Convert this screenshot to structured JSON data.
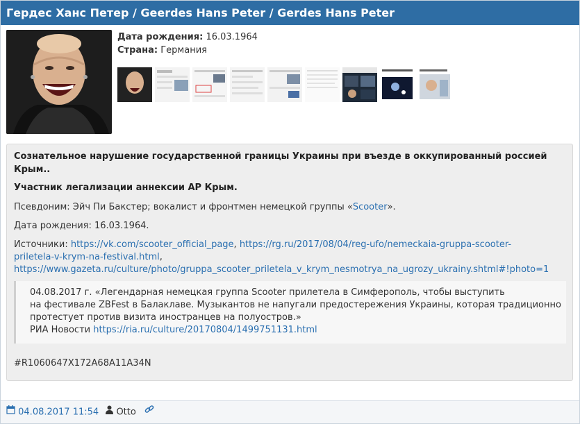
{
  "title": "Гердес Ханс Петер / Geerdes Hans Peter / Gerdes Hans Peter",
  "info": {
    "birth_label": "Дата рождения:",
    "birth_value": "16.03.1964",
    "country_label": "Страна:",
    "country_value": "Германия"
  },
  "thumbnails_count": 9,
  "body": {
    "headline": "Сознательное нарушение государственной границы Украины при въезде в оккупированный россией Крым..",
    "subheadline": "Участник легализации аннексии АР Крым.",
    "pseudonym_prefix": "Псевдоним:  Эйч Пи Бакстер;  вокалист и фронтмен немецкой группы «",
    "pseudonym_link": "Scooter",
    "pseudonym_suffix": "».",
    "birth_line": "Дата рождения: 16.03.1964.",
    "sources_label": "Источники: ",
    "source_1": "https://vk.com/scooter_official_page",
    "source_sep": ", ",
    "source_2a": "https://rg.ru/2017/08/04/reg-ufo/nemeckaia-gruppa-scooter-",
    "source_2b": "priletela-v-krym-na-festival.html",
    "source_sep2": ",",
    "source_3": "https://www.gazeta.ru/culture/photo/gruppa_scooter_priletela_v_krym_nesmotrya_na_ugrozy_ukrainy.shtml#!photo=1",
    "quote_line1": "04.08.2017 г. «Легендарная немецкая группа Scooter прилетела в Симферополь, чтобы выступить",
    "quote_line2": "на фестивале ZBFest в Балаклаве. Музыкантов не напугали предостережения Украины, которая традиционно",
    "quote_line3": "протестует против визита иностранцев на полуостров.»",
    "quote_source_label": "РИА Новости ",
    "quote_source_link": "https://ria.ru/culture/20170804/1499751131.html",
    "hash": "#R1060647X172A68A11A34N"
  },
  "footer": {
    "date": "04.08.2017 11:54",
    "author": "Otto"
  },
  "colors": {
    "header": "#2e6da4",
    "link": "#2a6fb0",
    "panel": "#eeeeee"
  }
}
